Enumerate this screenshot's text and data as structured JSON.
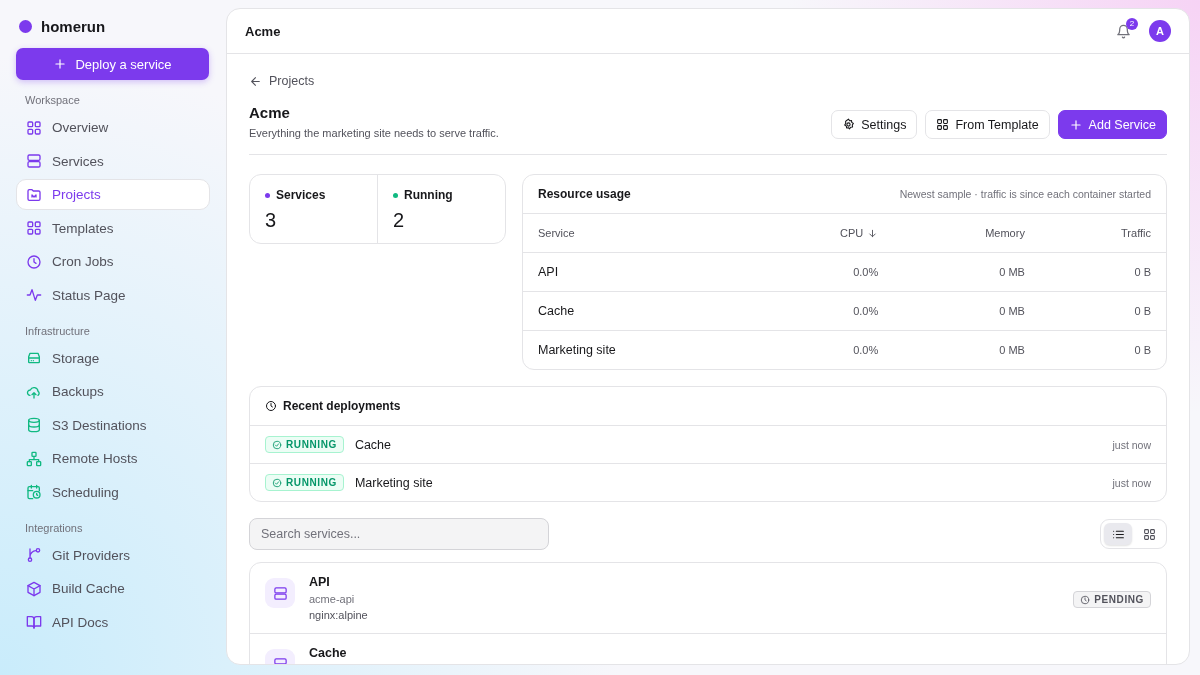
{
  "brand": {
    "name": "homerun"
  },
  "deploy_button": {
    "label": "Deploy a service"
  },
  "sidebar": {
    "sections": [
      {
        "title": "Workspace",
        "items": [
          {
            "label": "Overview",
            "selected": false
          },
          {
            "label": "Services",
            "selected": false
          },
          {
            "label": "Projects",
            "selected": true
          },
          {
            "label": "Templates",
            "selected": false
          },
          {
            "label": "Cron Jobs",
            "selected": false
          },
          {
            "label": "Status Page",
            "selected": false
          }
        ]
      },
      {
        "title": "Infrastructure",
        "items": [
          {
            "label": "Storage",
            "selected": false
          },
          {
            "label": "Backups",
            "selected": false
          },
          {
            "label": "S3 Destinations",
            "selected": false
          },
          {
            "label": "Remote Hosts",
            "selected": false
          },
          {
            "label": "Scheduling",
            "selected": false
          }
        ]
      },
      {
        "title": "Integrations",
        "items": [
          {
            "label": "Git Providers",
            "selected": false
          },
          {
            "label": "Build Cache",
            "selected": false
          },
          {
            "label": "API Docs",
            "selected": false
          }
        ]
      }
    ]
  },
  "topbar": {
    "title": "Acme",
    "notifications": "2",
    "avatar": "A"
  },
  "breadcrumb": "Projects",
  "project": {
    "title": "Acme",
    "description": "Everything the marketing site needs to serve traffic."
  },
  "actions": [
    {
      "label": "Settings",
      "kind": "settings"
    },
    {
      "label": "From Template",
      "kind": "template"
    },
    {
      "label": "Add Service",
      "kind": "primary"
    }
  ],
  "stats": [
    {
      "label": "Services",
      "value": "3",
      "color": "#7c3aed"
    },
    {
      "label": "Running",
      "value": "2",
      "color": "#10b981"
    }
  ],
  "resource_usage": {
    "title": "Resource usage",
    "note": "Newest sample · traffic is since each container started",
    "columns": [
      {
        "label": "Service",
        "sorted": false
      },
      {
        "label": "CPU",
        "sorted": true
      },
      {
        "label": "Memory",
        "sorted": false
      },
      {
        "label": "Traffic",
        "sorted": false
      }
    ],
    "rows": [
      [
        "API",
        "0.0%",
        "0 MB",
        "0 B"
      ],
      [
        "Cache",
        "0.0%",
        "0 MB",
        "0 B"
      ],
      [
        "Marketing site",
        "0.0%",
        "0 MB",
        "0 B"
      ]
    ]
  },
  "recent_deployments": {
    "title": "Recent deployments",
    "items": [
      {
        "status": "RUNNING",
        "kind": "running",
        "name": "Cache",
        "time": "just now"
      },
      {
        "status": "RUNNING",
        "kind": "running",
        "name": "Marketing site",
        "time": "just now"
      }
    ]
  },
  "search": {
    "placeholder": "Search services..."
  },
  "view_toggle": [
    {
      "kind": "list",
      "selected": true
    },
    {
      "kind": "grid",
      "selected": false
    }
  ],
  "services": [
    {
      "name": "API",
      "slug": "acme-api",
      "image": "nginx:alpine",
      "status": "PENDING",
      "kind": "pending"
    },
    {
      "name": "Cache"
    }
  ]
}
